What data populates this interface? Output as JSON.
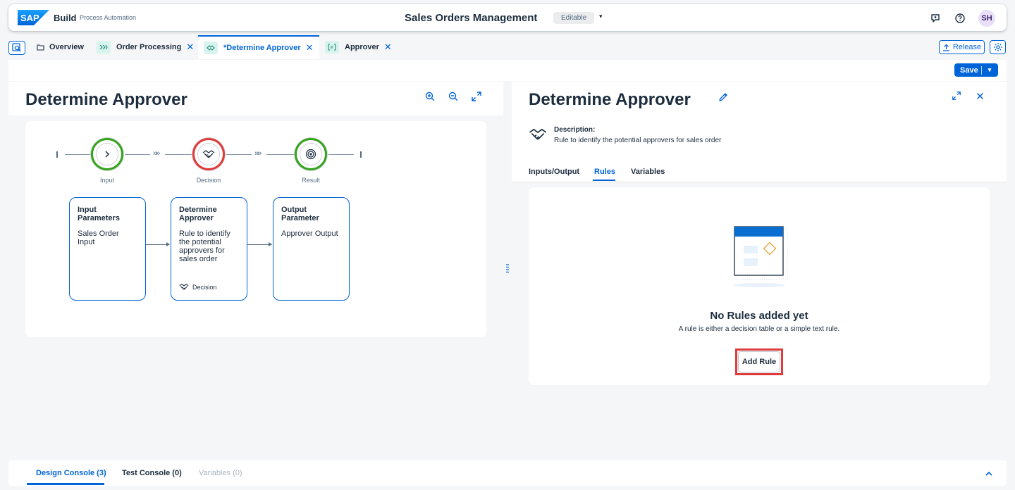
{
  "shell": {
    "logo": "SAP",
    "brand": "Build",
    "brand_sub": "Process Automation",
    "title": "Sales Orders Management",
    "status": "Editable",
    "status_caret": "▾",
    "avatar_initials": "SH",
    "icons": [
      "feedback-icon",
      "help-icon"
    ]
  },
  "tabs": {
    "items": [
      {
        "label": "Overview",
        "icon": "folder-icon",
        "closable": false,
        "active": false
      },
      {
        "label": "Order Processing",
        "icon": "process-icon",
        "closable": true,
        "active": false
      },
      {
        "label": "*Determine Approver",
        "icon": "decision-icon",
        "closable": true,
        "active": true
      },
      {
        "label": "Approver",
        "icon": "form-icon",
        "closable": true,
        "active": false
      }
    ],
    "close_glyph": "✕",
    "release_label": "Release"
  },
  "toolbar": {
    "save_label": "Save",
    "save_caret": "▾"
  },
  "left": {
    "title": "Determine Approver",
    "flow": {
      "nodes": [
        {
          "label": "Input",
          "status": "green",
          "icon": "chevron-right-icon"
        },
        {
          "label": "Decision",
          "status": "red",
          "icon": "handshake-icon"
        },
        {
          "label": "Result",
          "status": "green",
          "icon": "target-icon"
        }
      ],
      "connector": "»»",
      "cards": [
        {
          "title": "Input Parameters",
          "body": "Sales Order Input",
          "footer": ""
        },
        {
          "title": "Determine Approver",
          "body": "Rule to identify the potential approvers for sales order",
          "footer": "Decision"
        },
        {
          "title": "Output Parameter",
          "body": "Approver Output",
          "footer": ""
        }
      ]
    }
  },
  "right": {
    "title": "Determine Approver",
    "description_label": "Description:",
    "description_text": "Rule to identify the potential approvers for sales order",
    "tabs": [
      {
        "label": "Inputs/Output",
        "active": false
      },
      {
        "label": "Rules",
        "active": true
      },
      {
        "label": "Variables",
        "active": false
      }
    ],
    "empty_state": {
      "title": "No Rules added yet",
      "subtitle": "A rule is either a decision table or a simple text rule.",
      "button": "Add Rule"
    }
  },
  "bottom": {
    "tabs": [
      {
        "label": "Design Console (3)",
        "active": true,
        "disabled": false
      },
      {
        "label": "Test Console (0)",
        "active": false,
        "disabled": false
      },
      {
        "label": "Variables (0)",
        "active": false,
        "disabled": true
      }
    ]
  },
  "colors": {
    "accent": "#0064d9",
    "success": "#36a41d",
    "error": "#e03a3a",
    "highlight": "#e03a3a"
  }
}
